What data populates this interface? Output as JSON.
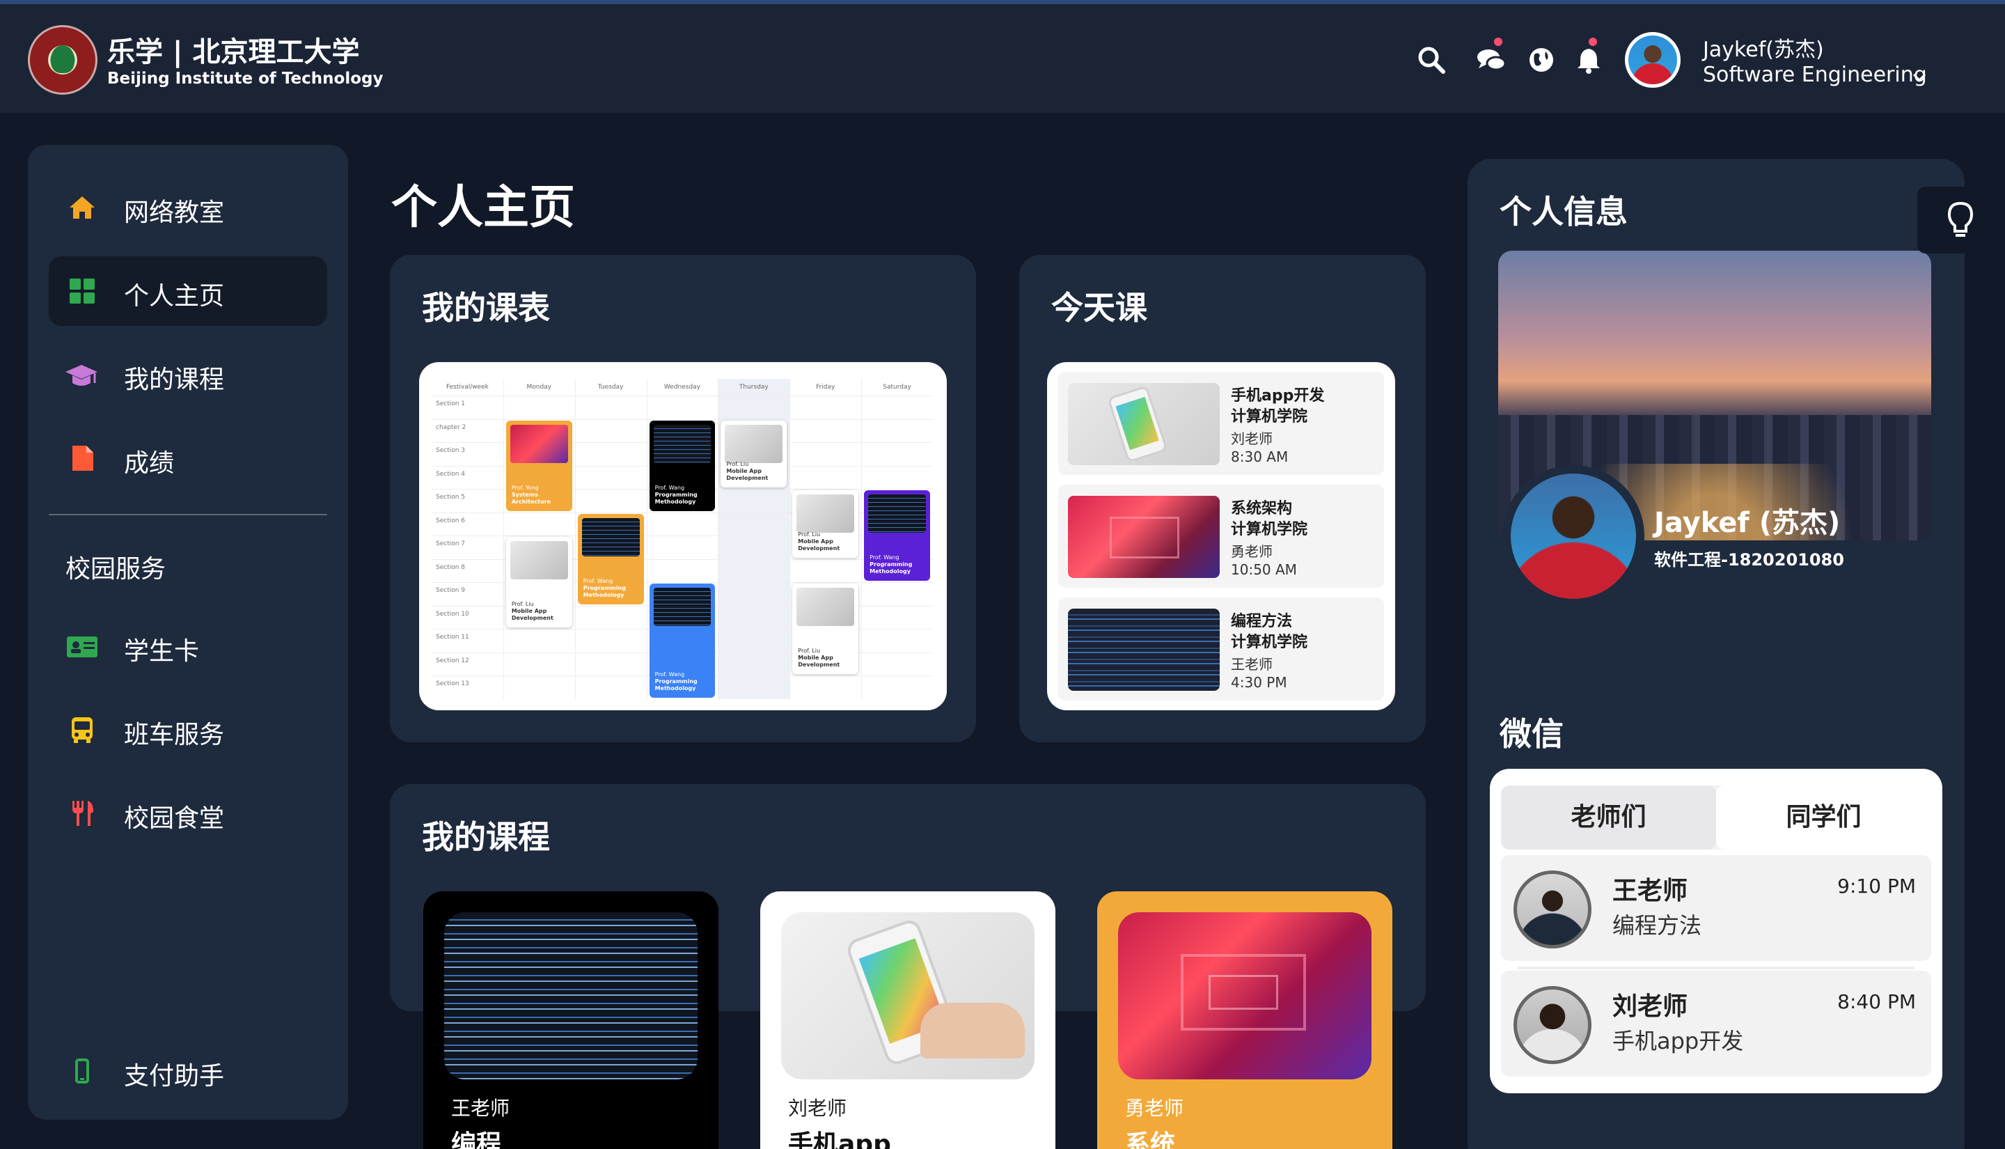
{
  "header": {
    "brand_title": "乐学 | 北京理工大学",
    "brand_subtitle": "Beijing Institute of Technology",
    "icons": [
      "search-icon",
      "chat-icon",
      "globe-icon",
      "bell-icon"
    ],
    "user_name": "Jaykef(苏杰)",
    "user_dept": "Software Engineering"
  },
  "sidebar": {
    "items": [
      {
        "label": "网络教室",
        "icon": "home-icon",
        "color": "#f5a524"
      },
      {
        "label": "个人主页",
        "icon": "grid-icon",
        "color": "#2fa84f"
      },
      {
        "label": "我的课程",
        "icon": "graduation-cap-icon",
        "color": "#c87ad9"
      },
      {
        "label": "成绩",
        "icon": "document-icon",
        "color": "#ff5a36"
      }
    ],
    "section_title": "校园服务",
    "services": [
      {
        "label": "学生卡",
        "icon": "id-card-icon",
        "color": "#2fa84f"
      },
      {
        "label": "班车服务",
        "icon": "bus-icon",
        "color": "#f5c518"
      },
      {
        "label": "校园食堂",
        "icon": "utensils-icon",
        "color": "#ff4d4d"
      }
    ],
    "bottom_item": {
      "label": "支付助手",
      "icon": "phone-icon",
      "color": "#2fa84f"
    }
  },
  "main": {
    "page_title": "个人主页",
    "schedule_title": "我的课表",
    "timetable": {
      "days": [
        "Festival/week",
        "Monday",
        "Tuesday",
        "Wednesday",
        "Thursday",
        "Friday",
        "Saturday"
      ],
      "rows": [
        "Section 1",
        "chapter 2",
        "Section 3",
        "Section 4",
        "Section 5",
        "Section 6",
        "Section 7",
        "Section 8",
        "Section 9",
        "Section 10",
        "Section 11",
        "Section 12",
        "Section 13"
      ],
      "blocks": [
        {
          "teacher": "Prof. Yong",
          "title": "Systems Architecture"
        },
        {
          "teacher": "Prof. Wang",
          "title": "Programming Methodology"
        },
        {
          "teacher": "Prof. Liu",
          "title": "Mobile App Development"
        },
        {
          "teacher": "Prof. Liu",
          "title": "Mobile App Development"
        },
        {
          "teacher": "Prof. Wang",
          "title": "Programming Methodology"
        },
        {
          "teacher": "Prof. Liu",
          "title": "Mobile App Development"
        },
        {
          "teacher": "Prof. Wang",
          "title": "Programming Methodology"
        },
        {
          "teacher": "Prof. Wang",
          "title": "Programming Methodology"
        },
        {
          "teacher": "Prof. Liu",
          "title": "Mobile App Development"
        }
      ]
    },
    "today_title": "今天课",
    "today": [
      {
        "course": "手机app开发",
        "school": "计算机学院",
        "teacher": "刘老师",
        "time": "8:30 AM"
      },
      {
        "course": "系统架构",
        "school": "计算机学院",
        "teacher": "勇老师",
        "time": "10:50 AM"
      },
      {
        "course": "编程方法",
        "school": "计算机学院",
        "teacher": "王老师",
        "time": "4:30 PM"
      }
    ],
    "courses_title": "我的课程",
    "courses": [
      {
        "teacher": "王老师",
        "name": "编程"
      },
      {
        "teacher": "刘老师",
        "name": "手机app"
      },
      {
        "teacher": "勇老师",
        "name": "系统"
      }
    ]
  },
  "right": {
    "title": "个人信息",
    "profile_name": "Jaykef (苏杰)",
    "profile_id": "软件工程-1820201080",
    "wechat_title": "微信",
    "tabs": [
      "老师们",
      "同学们"
    ],
    "chats": [
      {
        "name": "王老师",
        "message": "编程方法",
        "time": "9:10  PM"
      },
      {
        "name": "刘老师",
        "message": "手机app开发",
        "time": "8:40  PM"
      }
    ]
  }
}
